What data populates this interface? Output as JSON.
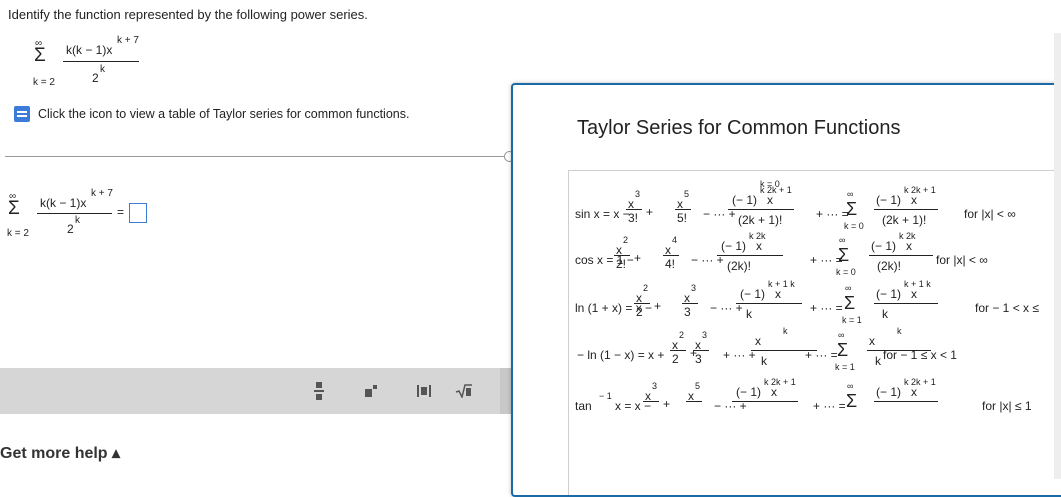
{
  "question": {
    "prompt": "Identify the function represented by the following power series."
  },
  "series_display": {
    "sigma": "Σ",
    "upper": "∞",
    "lower": "k = 2",
    "numerator": "k(k − 1)x",
    "numerator_exp": "k + 7",
    "denominator": "2",
    "denominator_exp": "k"
  },
  "hint": {
    "text": "Click the icon to view a table of Taylor series for common functions."
  },
  "answer_row": {
    "sigma": "Σ",
    "upper": "∞",
    "lower": "k = 2",
    "numerator": "k(k − 1)x",
    "numerator_exp": "k + 7",
    "denominator": "2",
    "denominator_exp": "k",
    "equals": "="
  },
  "toolbar": {
    "buttons": [
      "fraction-tool",
      "exponent-tool",
      "absolute-value-tool",
      "sqrt-tool"
    ]
  },
  "help": {
    "label": "Get more help ▴"
  },
  "popup": {
    "title": "Taylor Series for Common Functions",
    "rows": [
      {
        "name": "sin",
        "lhs": "sin x = x −",
        "t1n": "x",
        "t1e": "3",
        "t1d": "3!",
        "op1": "+",
        "t2n": "x",
        "t2e": "5",
        "t2d": "5!",
        "dots": "− ··· +",
        "gn": "(− 1)",
        "gne": "k  2k + 1",
        "gnx": "x",
        "gd": "(2k + 1)!",
        "tail": "+ ··· =",
        "sum_upper": "∞",
        "sum_lower": "k = 0",
        "sn": "(− 1)",
        "sne": "k  2k + 1",
        "snx": "x",
        "sd": "(2k + 1)!",
        "cond": "for |x| < ∞",
        "top": "k = 0"
      },
      {
        "name": "cos",
        "lhs": "cos x = 1 −",
        "t1n": "x",
        "t1e": "2",
        "t1d": "2!",
        "op1": "+",
        "t2n": "x",
        "t2e": "4",
        "t2d": "4!",
        "dots": "− ··· +",
        "gn": "(− 1)",
        "gne": "k  2k",
        "gnx": "x",
        "gd": "(2k)!",
        "tail": "+ ··· =",
        "sum_upper": "∞",
        "sum_lower": "k = 0",
        "sn": "(− 1)",
        "sne": "k  2k",
        "snx": "x",
        "sd": "(2k)!",
        "cond": "for |x| < ∞"
      },
      {
        "name": "ln1px",
        "lhs": "ln (1 + x) = x −",
        "t1n": "x",
        "t1e": "2",
        "t1d": "2",
        "op1": "+",
        "t2n": "x",
        "t2e": "3",
        "t2d": "3",
        "dots": "− ··· +",
        "gn": "(− 1)",
        "gne": "k + 1  k",
        "gnx": "x",
        "gd": "k",
        "tail": "+ ··· =",
        "sum_upper": "∞",
        "sum_lower": "k = 1",
        "sn": "(− 1)",
        "sne": "k + 1  k",
        "snx": "x",
        "sd": "k",
        "cond": "for  − 1 < x ≤"
      },
      {
        "name": "negln1mx",
        "lhs": "− ln (1 − x) = x +",
        "t1n": "x",
        "t1e": "2",
        "t1d": "2",
        "op1": "+",
        "t2n": "x",
        "t2e": "3",
        "t2d": "3",
        "dots": "+ ··· +",
        "gn": "x",
        "gne": "k",
        "gnx": "",
        "gd": "k",
        "tail": "+ ··· =",
        "sum_upper": "∞",
        "sum_lower": "k = 1",
        "sn": "x",
        "sne": "k",
        "snx": "",
        "sd": "k",
        "cond": "for  − 1 ≤ x < 1"
      },
      {
        "name": "arctan",
        "lhs": "tan",
        "lhs_exp": "− 1",
        "lhs2": "x = x −",
        "t1n": "x",
        "t1e": "3",
        "t1d": "",
        "op1": "+",
        "t2n": "x",
        "t2e": "5",
        "t2d": "",
        "dots": "− ··· +",
        "gn": "(− 1)",
        "gne": "k  2k + 1",
        "gnx": "x",
        "gd": "",
        "tail": "+ ··· =",
        "sum_upper": "∞",
        "sum_lower": "",
        "sn": "(− 1)",
        "sne": "k  2k + 1",
        "snx": "x",
        "sd": "",
        "cond": "for |x| ≤ 1"
      }
    ]
  }
}
